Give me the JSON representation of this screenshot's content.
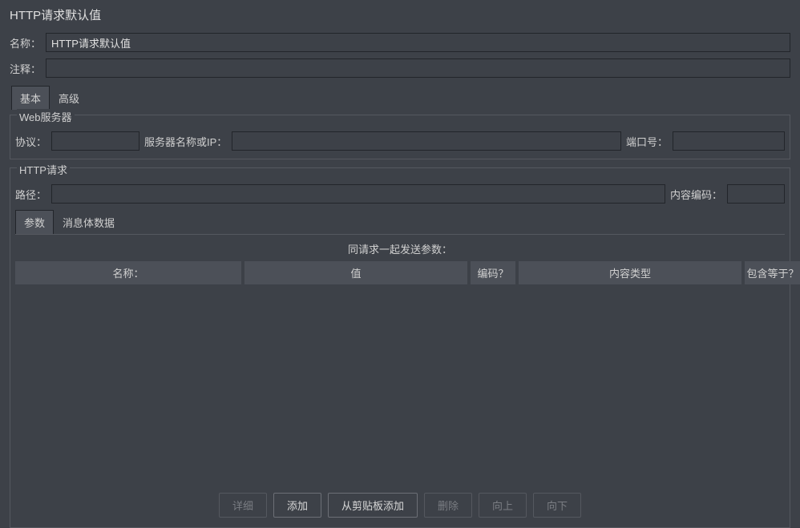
{
  "page_title": "HTTP请求默认值",
  "labels": {
    "name": "名称：",
    "comment": "注释："
  },
  "fields": {
    "name_value": "HTTP请求默认值",
    "comment_value": ""
  },
  "tabs": {
    "basic": "基本",
    "advanced": "高级"
  },
  "web_server": {
    "legend": "Web服务器",
    "protocol_label": "协议：",
    "protocol_value": "",
    "server_label": "服务器名称或IP：",
    "server_value": "",
    "port_label": "端口号：",
    "port_value": ""
  },
  "http_request": {
    "legend": "HTTP请求",
    "path_label": "路径：",
    "path_value": "",
    "encoding_label": "内容编码：",
    "encoding_value": "",
    "sub_tabs": {
      "params": "参数",
      "body": "消息体数据"
    },
    "params_title": "同请求一起发送参数：",
    "columns": {
      "name": "名称：",
      "value": "值",
      "encode": "编码？",
      "content_type": "内容类型",
      "include_equals": "包含等于？"
    }
  },
  "buttons": {
    "detail": "详细",
    "add": "添加",
    "add_from_clipboard": "从剪贴板添加",
    "delete": "删除",
    "up": "向上",
    "down": "向下"
  }
}
